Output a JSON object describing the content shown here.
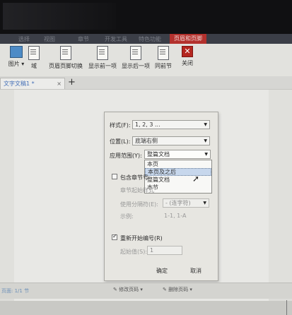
{
  "menubar": {
    "tabs": [
      "选择",
      "视图",
      "章节",
      "开发工具",
      "特色功能",
      "页眉和页脚"
    ],
    "active_index": 5
  },
  "ribbon": {
    "buttons": [
      "图片",
      "域",
      "页眉页脚切换",
      "显示前一项",
      "显示后一项",
      "同前节",
      "关闭"
    ]
  },
  "tabbar": {
    "doc_tab": "文字文稿1 *",
    "close_glyph": "×",
    "add_glyph": "+"
  },
  "dialog": {
    "style_label": "样式(F):",
    "style_value": "1, 2, 3 ...",
    "position_label": "位置(L):",
    "position_value": "底端右侧",
    "scope_label": "应用范围(Y):",
    "scope_value": "整篇文档",
    "scope_options": [
      "本页",
      "本页及之后",
      "整篇文档",
      "本节"
    ],
    "scope_highlight_index": 1,
    "include_chapter_label": "包含章节号",
    "include_chapter_checked": false,
    "chapter_start_label": "章节起始样式",
    "separator_label": "使用分隔符(E):",
    "separator_value": "- (连字符)",
    "example_label": "示例:",
    "example_value": "1-1, 1-A",
    "restart_label": "重新开始编号(R)",
    "restart_checked": true,
    "start_value_label": "起始值(S):",
    "start_value": "1",
    "ok_label": "确定",
    "cancel_label": "取消"
  },
  "bottom": {
    "status_left": "页面: 1/1 节",
    "modify_label": "修改页码",
    "delete_label": "删除页码"
  }
}
